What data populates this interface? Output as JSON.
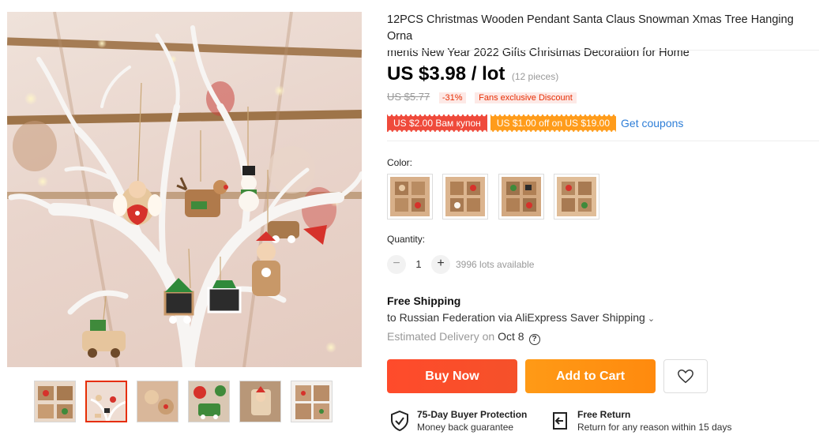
{
  "product": {
    "title": "12PCS Christmas Wooden Pendant Santa Claus Snowman Xmas Tree Hanging Orna ments New Year 2022 Gifts Christmas Decoration for Home",
    "title_line1": "12PCS Christmas Wooden Pendant Santa Claus Snowman Xmas Tree Hanging Orna",
    "title_line2": "ments New Year 2022 Gifts Christmas Decoration for Home"
  },
  "price": {
    "current": "US $3.98 / lot",
    "unit": "(12 pieces)",
    "original": "US $5.77",
    "discount": "-31%",
    "fans_label": "Fans exclusive Discount"
  },
  "coupons": {
    "items": [
      "US $2.00 Вам купон",
      "US $1.00 off on US $19.00"
    ],
    "get_coupons_label": "Get coupons"
  },
  "color": {
    "label": "Color:",
    "swatch_count": 4
  },
  "quantity": {
    "label": "Quantity:",
    "value": "1",
    "minus": "−",
    "plus": "+",
    "available": "3996 lots available"
  },
  "shipping": {
    "title": "Free Shipping",
    "destination": "to Russian Federation via AliExpress Saver Shipping",
    "chevron": "⌄",
    "delivery_label": "Estimated Delivery on",
    "delivery_date": "Oct 8",
    "help": "?"
  },
  "actions": {
    "buy_now": "Buy Now",
    "add_to_cart": "Add to Cart"
  },
  "guarantees": [
    {
      "icon": "shield-check-icon",
      "title": "75-Day Buyer Protection",
      "subtitle": "Money back guarantee"
    },
    {
      "icon": "return-arrow-icon",
      "title": "Free Return",
      "subtitle": "Return for any reason within 15 days"
    }
  ],
  "gallery": {
    "thumbnail_count": 6,
    "active_index": 1
  },
  "colors": {
    "accent_red": "#e62e04",
    "buy_button": "#ff4b2b",
    "cart_button": "#ff9a16",
    "coupon_red": "#ef4a3b",
    "coupon_orange": "#ff9c1b",
    "link_blue": "#2e7ed7"
  }
}
